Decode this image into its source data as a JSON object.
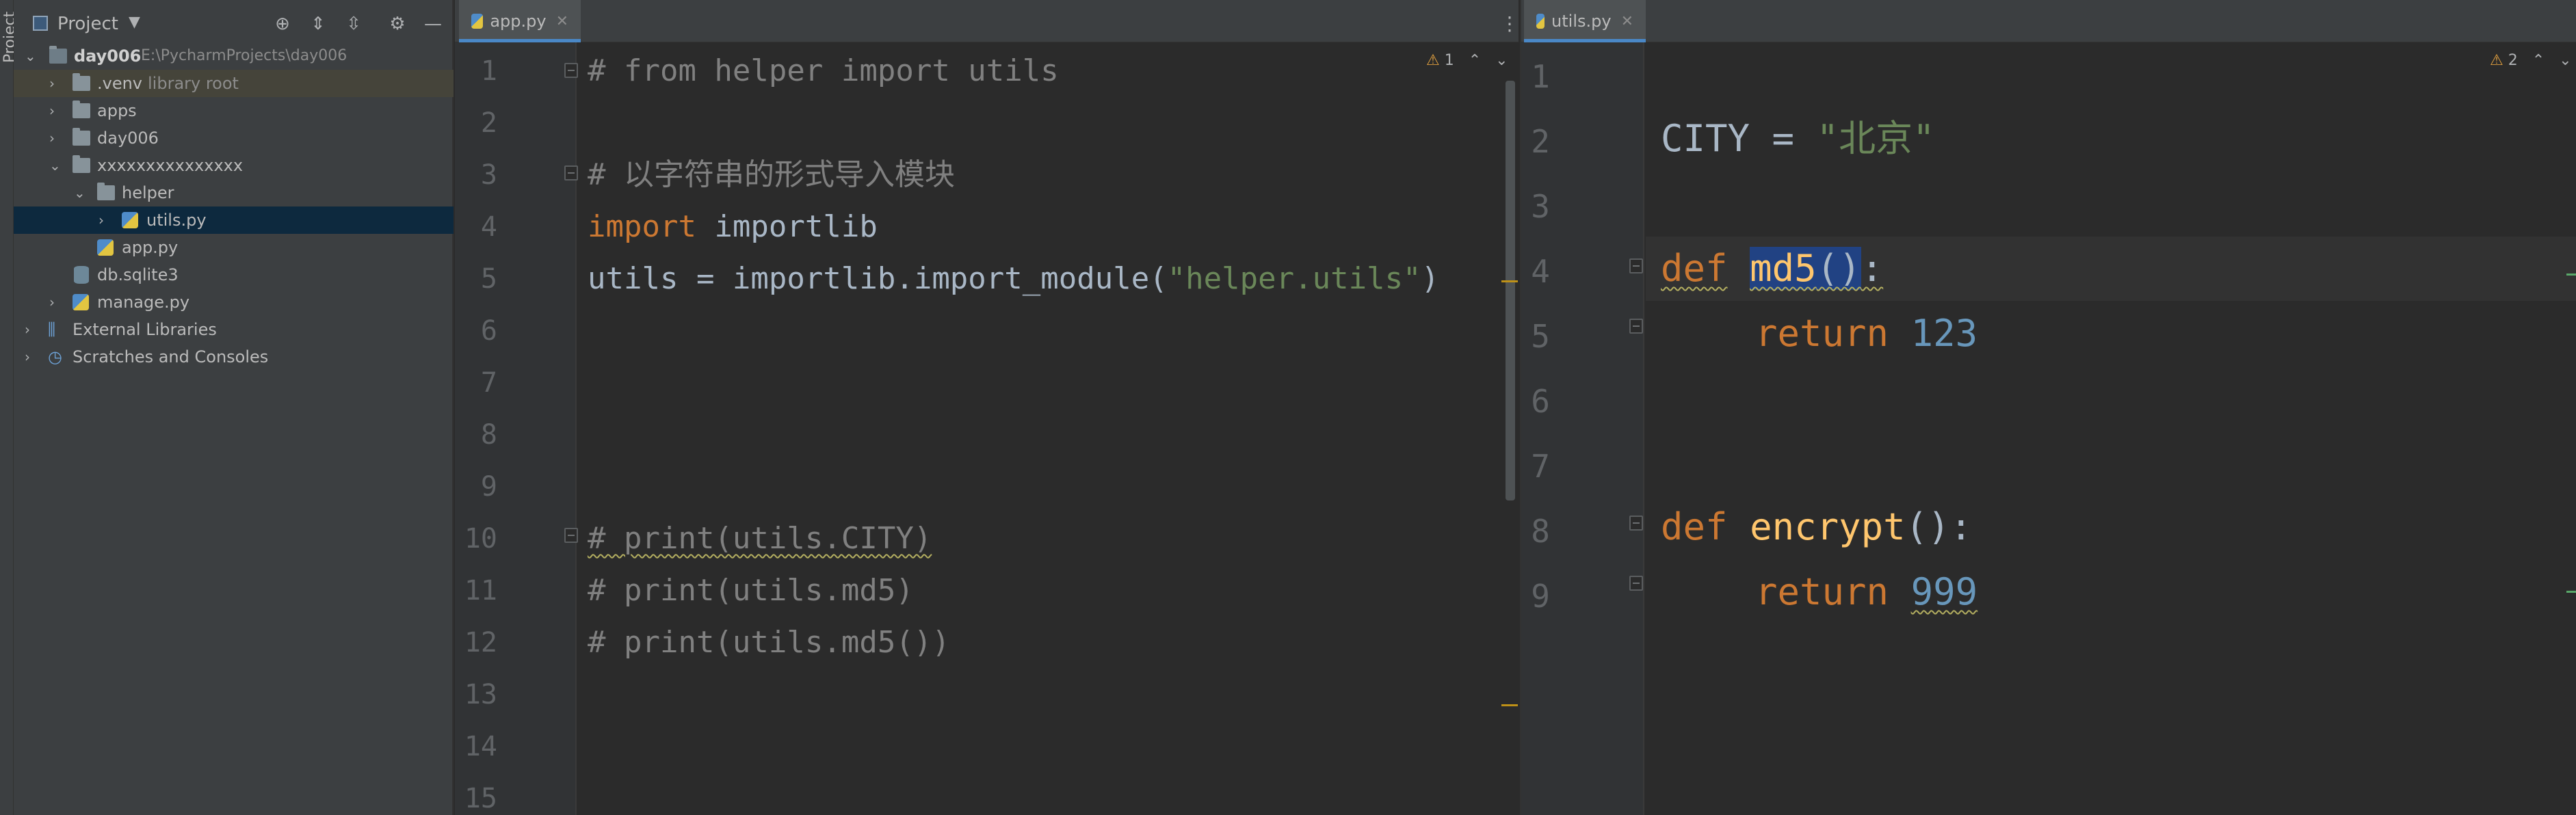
{
  "sidebar_stripe": {
    "label": "Project"
  },
  "project_panel": {
    "title": "Project",
    "tree": [
      {
        "label": "day006",
        "path": "E:\\PycharmProjects\\day006"
      },
      {
        "label": ".venv",
        "suffix": "library root"
      },
      {
        "label": "apps"
      },
      {
        "label": "day006"
      },
      {
        "label": "xxxxxxxxxxxxxxx"
      },
      {
        "label": "helper"
      },
      {
        "label": "utils.py"
      },
      {
        "label": "app.py"
      },
      {
        "label": "db.sqlite3"
      },
      {
        "label": "manage.py"
      },
      {
        "label": "External Libraries"
      },
      {
        "label": "Scratches and Consoles"
      }
    ]
  },
  "left_editor": {
    "tab_label": "app.py",
    "warnings": "1",
    "line_numbers": [
      "1",
      "2",
      "3",
      "4",
      "5",
      "6",
      "7",
      "8",
      "9",
      "10",
      "11",
      "12",
      "13",
      "14",
      "15"
    ],
    "lines": {
      "l1": "# from helper import utils",
      "l3": "# 以字符串的形式导入模块",
      "l4_kw": "import",
      "l4_rest": " importlib",
      "l5_a": "utils = importlib.import_module(",
      "l5_str": "\"helper.utils\"",
      "l5_b": ")",
      "l10": "# print(utils.CITY)",
      "l11": "# print(utils.md5)",
      "l12": "# print(utils.md5())"
    }
  },
  "right_editor": {
    "tab_label": "utils.py",
    "warnings": "2",
    "line_numbers": [
      "1",
      "2",
      "3",
      "4",
      "5",
      "6",
      "7",
      "8",
      "9"
    ],
    "lines": {
      "l2_a": "CITY = ",
      "l2_str": "\"北京\"",
      "l4_kw": "def",
      "l4_fn": "md5",
      "l4_paren": "()",
      "l4_colon": ":",
      "l5_kw": "return",
      "l5_num": "123",
      "l8_kw": "def",
      "l8_fn": "encrypt",
      "l8_rest": "():",
      "l9_kw": "return",
      "l9_num": "999"
    }
  }
}
